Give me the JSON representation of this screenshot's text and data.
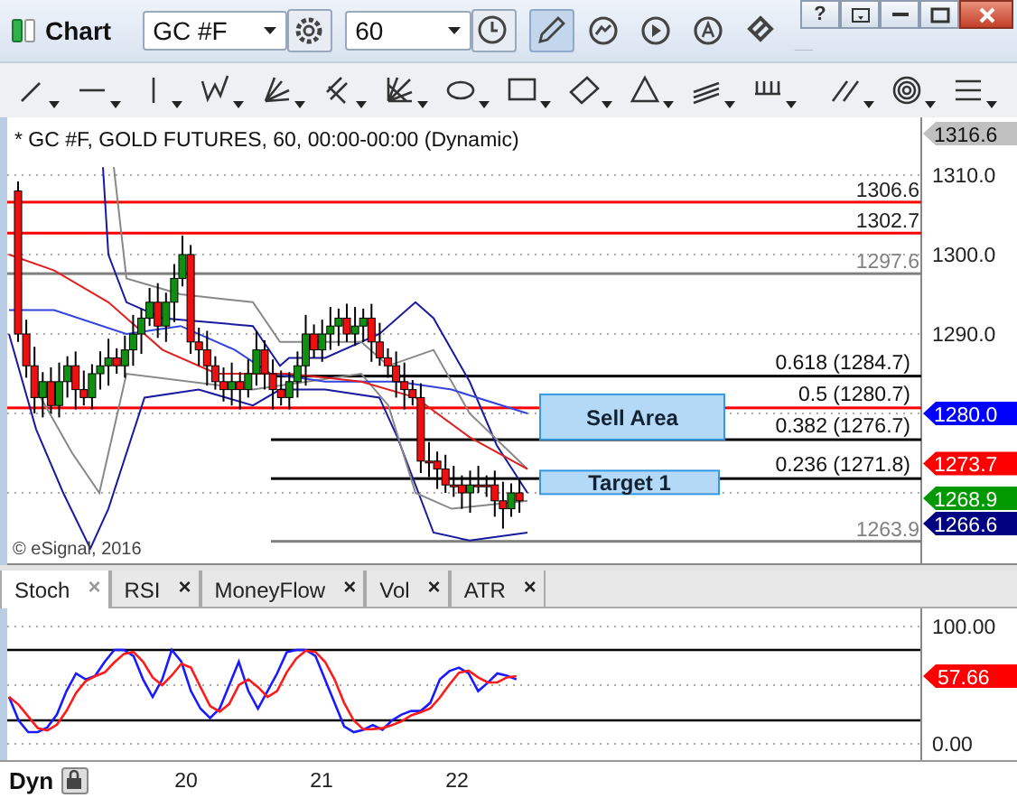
{
  "window": {
    "title": "Chart",
    "help": "?"
  },
  "toolbar": {
    "symbol": "GC #F",
    "interval": "60",
    "pencil_selected": true
  },
  "chart": {
    "legend": "* GC #F, GOLD FUTURES, 60, 00:00-00:00 (Dynamic)",
    "copyright": "© eSignal, 2016",
    "axis_labels": [
      "1310.0",
      "1300.0",
      "1290.0"
    ],
    "level_lines": [
      {
        "label": "1306.6",
        "color": "#ff0000"
      },
      {
        "label": "1302.7",
        "color": "#ff0000"
      },
      {
        "label": "1297.6",
        "color": "#808080"
      },
      {
        "label": "1263.9",
        "color": "#808080"
      }
    ],
    "fib_levels": [
      {
        "label": "0.618 (1284.7)",
        "color": "#000000"
      },
      {
        "label": "0.5 (1280.7)",
        "color": "#ff0000"
      },
      {
        "label": "0.382 (1276.7)",
        "color": "#000000"
      },
      {
        "label": "0.236 (1271.8)",
        "color": "#000000"
      }
    ],
    "zones": [
      {
        "label": "Sell Area"
      },
      {
        "label": "Target 1"
      }
    ],
    "price_tags": [
      {
        "label": "1316.6",
        "color": "#c0c0c0"
      },
      {
        "label": "1280.0",
        "color": "#0000ff"
      },
      {
        "label": "1273.7",
        "color": "#ff0000"
      },
      {
        "label": "1268.9",
        "color": "#009900"
      },
      {
        "label": "1266.6",
        "color": "#000080"
      }
    ]
  },
  "indicator_tabs": [
    {
      "label": "Stoch",
      "close": "×",
      "selected": true
    },
    {
      "label": "RSI",
      "close": "×",
      "selected": false
    },
    {
      "label": "MoneyFlow",
      "close": "×",
      "selected": false
    },
    {
      "label": "Vol",
      "close": "×",
      "selected": false
    },
    {
      "label": "ATR",
      "close": "×",
      "selected": false
    }
  ],
  "stoch": {
    "axis_labels": [
      "100.00",
      "0.00"
    ],
    "price_tag": {
      "label": "57.66",
      "color": "#ff0000"
    }
  },
  "footer": {
    "mode": "Dyn",
    "dates": [
      "20",
      "21",
      "22"
    ]
  }
}
